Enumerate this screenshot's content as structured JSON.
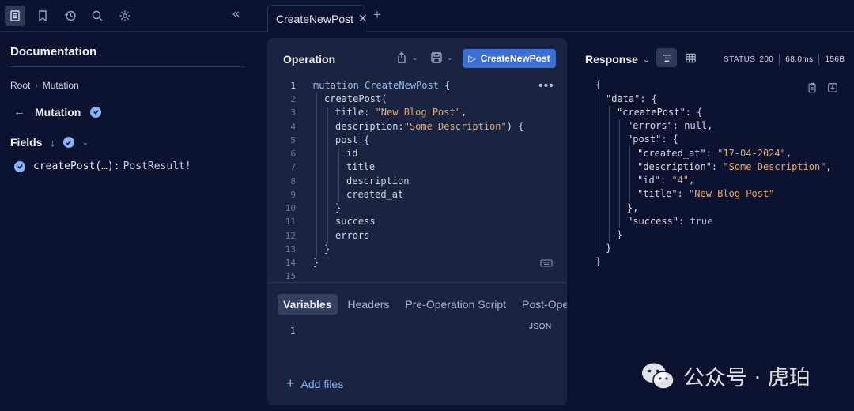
{
  "tab": {
    "title": "CreateNewPost"
  },
  "docs": {
    "title": "Documentation",
    "breadcrumb": [
      "Root",
      "Mutation"
    ],
    "current": "Mutation",
    "fields_label": "Fields",
    "field": {
      "name": "createPost(…):",
      "type": "PostResult!"
    }
  },
  "operation": {
    "title": "Operation",
    "run_label": "CreateNewPost",
    "line_numbers": [
      "1",
      "2",
      "3",
      "4",
      "5",
      "6",
      "7",
      "8",
      "9",
      "10",
      "11",
      "12",
      "13",
      "14",
      "15"
    ],
    "code": {
      "l1_kw": "mutation",
      "l1_name": "CreateNewPost",
      "l1_brace": " {",
      "l2": "createPost(",
      "l3_key": "title: ",
      "l3_val": "\"New Blog Post\"",
      "l3_end": ",",
      "l4_key": "description:",
      "l4_val": "\"Some Description\"",
      "l4_end": ") {",
      "l5": "post {",
      "l6": "id",
      "l7": "title",
      "l8": "description",
      "l9": "created_at",
      "l10": "}",
      "l11": "success",
      "l12": "errors",
      "l13": "}",
      "l14": "}"
    },
    "tabs": [
      "Variables",
      "Headers",
      "Pre-Operation Script",
      "Post-Operatio"
    ],
    "json_label": "JSON",
    "variables_line": "1",
    "add_files": "Add files"
  },
  "response": {
    "title": "Response",
    "status_label": "STATUS",
    "status_code": "200",
    "time": "68.0ms",
    "size": "156B",
    "lines": {
      "r1": "{",
      "r2_k": "\"data\"",
      "r2_e": ": {",
      "r3_k": "\"createPost\"",
      "r3_e": ": {",
      "r4_k": "\"errors\"",
      "r4_v": "null",
      "r4_e": ",",
      "r5_k": "\"post\"",
      "r5_e": ": {",
      "r6_k": "\"created_at\"",
      "r6_v": "\"17-04-2024\"",
      "r6_e": ",",
      "r7_k": "\"description\"",
      "r7_v": "\"Some Description\"",
      "r7_e": ",",
      "r8_k": "\"id\"",
      "r8_v": "\"4\"",
      "r8_e": ",",
      "r9_k": "\"title\"",
      "r9_v": "\"New Blog Post\"",
      "r10": "},",
      "r11_k": "\"success\"",
      "r11_v": "true",
      "r12": "}",
      "r13": "}",
      "r14": "}"
    }
  },
  "watermark": {
    "text": "公众号 · 虎珀"
  }
}
